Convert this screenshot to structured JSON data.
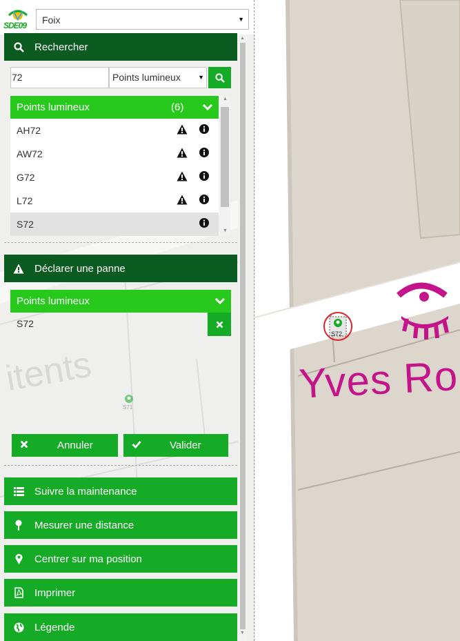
{
  "header": {
    "logo_text": "SDE09",
    "city_select_value": "Foix"
  },
  "search_section": {
    "title": "Rechercher",
    "search_value": "72",
    "type_select_value": "Points lumineux",
    "results_header_label": "Points lumineux",
    "results_count": "(6)",
    "results": [
      {
        "label": "AH72",
        "has_warning": true
      },
      {
        "label": "AW72",
        "has_warning": true
      },
      {
        "label": "G72",
        "has_warning": true
      },
      {
        "label": "L72",
        "has_warning": true
      },
      {
        "label": "S72",
        "has_warning": false,
        "selected": true
      }
    ]
  },
  "panne_section": {
    "title": "Déclarer une panne",
    "sub_header": "Points lumineux",
    "selected_item": "S72",
    "cancel_label": "Annuler",
    "validate_label": "Valider"
  },
  "menu": {
    "maintenance": "Suivre la maintenance",
    "distance": "Mesurer une distance",
    "center": "Centrer sur ma position",
    "print": "Imprimer",
    "legend": "Légende"
  },
  "map": {
    "sidebar_map_labels": [
      "itents",
      "S71"
    ],
    "marker_label": "S72",
    "street_label": "Yves Ro",
    "colors": {
      "map_bg": "#dcd6cc",
      "road": "#ffffff",
      "label_magenta": "#c4148a",
      "marker_ring": "#e0202a"
    }
  },
  "colors": {
    "dark_green": "#0b5a20",
    "green": "#16ab27",
    "light_green": "#27c91c"
  }
}
